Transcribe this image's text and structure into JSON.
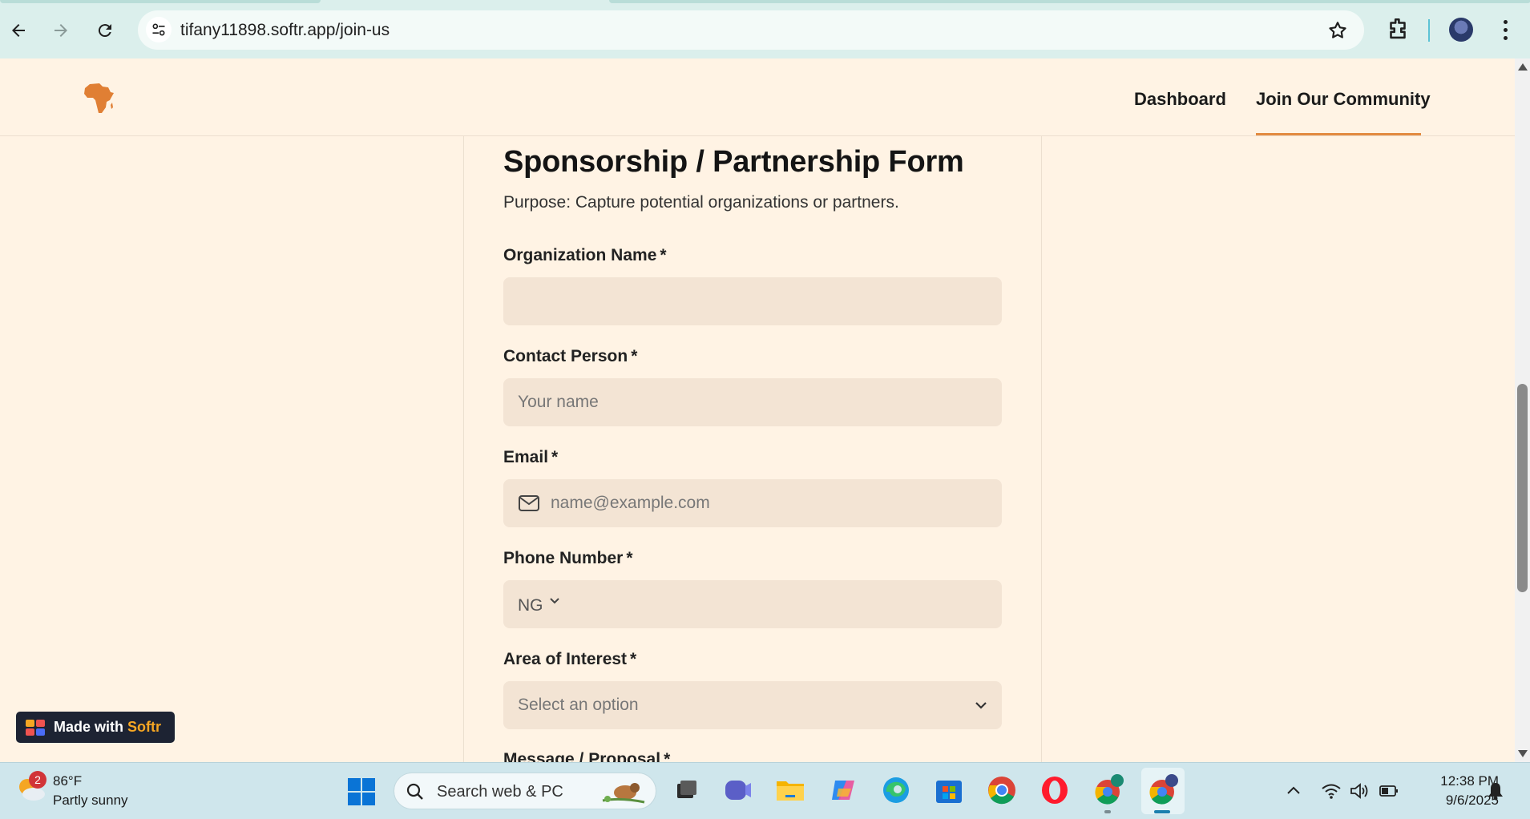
{
  "browser": {
    "url": "tifany11898.softr.app/join-us",
    "back_icon": "back-arrow-icon",
    "forward_icon": "forward-arrow-icon",
    "reload_icon": "reload-icon",
    "bookmark_icon": "star-icon",
    "extensions_icon": "puzzle-icon",
    "menu_icon": "kebab-icon"
  },
  "site": {
    "logo_icon": "africa-map-icon",
    "nav": [
      {
        "label": "Dashboard",
        "active": false
      },
      {
        "label": "Join Our Community",
        "active": true
      }
    ],
    "accent_color": "#e28a3f",
    "background_color": "#fff3e4"
  },
  "form": {
    "title": "Sponsorship / Partnership Form",
    "subtitle": "Purpose: Capture potential organizations or partners.",
    "required_mark": "*",
    "fields": {
      "organization": {
        "label": "Organization Name",
        "placeholder": ""
      },
      "contact": {
        "label": "Contact Person",
        "placeholder": "Your name"
      },
      "email": {
        "label": "Email",
        "placeholder": "name@example.com"
      },
      "phone": {
        "label": "Phone Number",
        "country_code": "NG"
      },
      "interest": {
        "label": "Area of Interest",
        "placeholder": "Select an option"
      },
      "message": {
        "label": "Message / Proposal"
      }
    }
  },
  "badge": {
    "prefix": "Made with",
    "brand": "Softr"
  },
  "taskbar": {
    "weather": {
      "temp": "86°F",
      "desc": "Partly sunny",
      "notifications": "2"
    },
    "search_placeholder": "Search web & PC",
    "apps": [
      "task-view-icon",
      "teams-icon",
      "file-explorer-icon",
      "copilot-icon",
      "edge-icon",
      "store-icon",
      "chrome-icon",
      "opera-icon",
      "chrome-profile-icon",
      "chrome-active-icon"
    ],
    "clock": {
      "time": "12:38 PM",
      "date": "9/6/2025"
    }
  }
}
